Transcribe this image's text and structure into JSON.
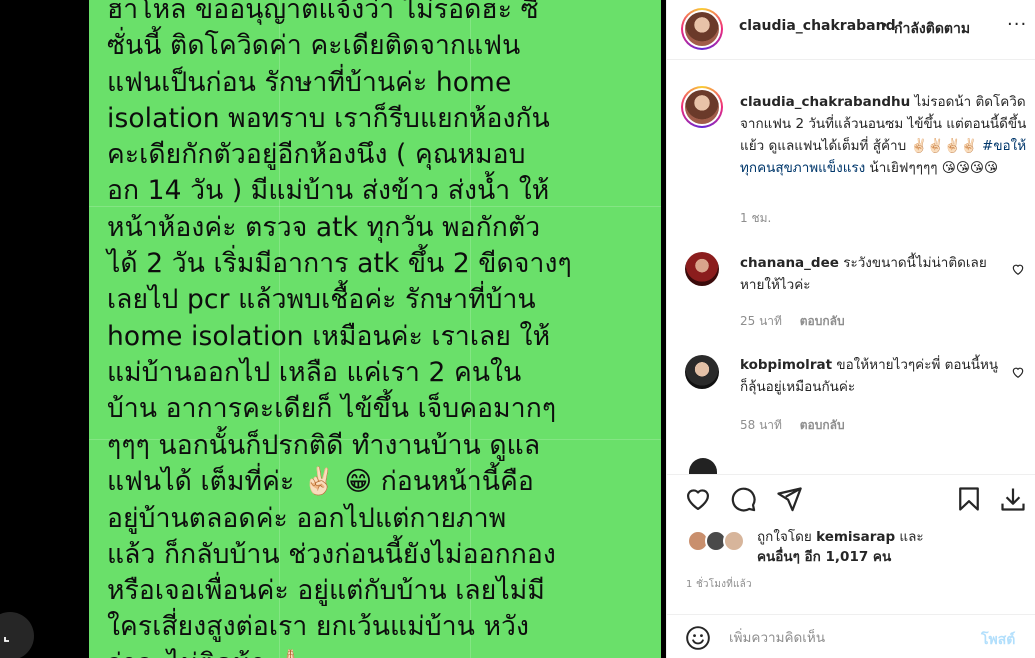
{
  "post_image": {
    "lines": [
      "ฮาโหล ขออนุญาตแจ้งว่า ไม่รอดฮะ ซี",
      "ซั่นนี้ ติดโควิดค่า คะเดียติดจากแฟน",
      "แฟนเป็นก่อน รักษาที่บ้านค่ะ home",
      "isolation พอทราบ เราก็รีบแยกห้องกัน",
      "คะเดียกักตัวอยู่อีกห้องนึง ( คุณหมอบ",
      "อก 14 วัน ) มีแม่บ้าน ส่งข้าว ส่งน้ำ ให้",
      "หน้าห้องค่ะ ตรวจ atk ทุกวัน พอกักตัว",
      "ได้ 2 วัน เริ่มมีอาการ atk ขึ้น 2 ขีดจางๆ",
      "เลยไป pcr แล้วพบเชื้อค่ะ รักษาที่บ้าน",
      "home isolation เหมือนค่ะ เราเลย ให้",
      "แม่บ้านออกไป เหลือ แค่เรา 2 คนใน",
      "บ้าน อาการคะเดียก็ ไข้ขึ้น เจ็บคอมากๆ",
      "ๆๆๆ นอกนั้นก็ปรกติดี ทำงานบ้าน ดูแล"
    ],
    "line14_a": "แฟนได้ เต็มที่ค่ะ",
    "line14_b": "ก่อนหน้านี้คือ",
    "lines_after": [
      "อยู่บ้านตลอดค่ะ ออกไปแต่กายภาพ",
      "แล้ว ก็กลับบ้าน ช่วงก่อนนี้ยังไม่ออกกอง",
      "หรือเจอเพื่อนค่ะ อยู่แต่กับบ้าน เลยไม่มี",
      "ใครเสี่ยงสูงต่อเรา ยกเว้นแม่บ้าน หวัง"
    ],
    "last_line": "ว่าจะไม่ติดน้า",
    "emoji_victory": "✌🏻",
    "emoji_grin": "😁",
    "emoji_pray": "🙏🏻"
  },
  "header": {
    "username": "claudia_chakraband",
    "dot": "•",
    "follow_label": "กำลังติดตาม",
    "more": "···"
  },
  "caption": {
    "username": "claudia_chakrabandhu",
    "text": "ไม่รอดน้า ติดโควิดจากแฟน 2 วันที่แล้วนอนซม ไข้ขึ้น แต่ตอนนี้ดีขึ้นแย้ว ดูแลแฟนได้เต็มที่ สู้ค้าบ",
    "emojis": "✌🏻✌🏻✌🏻✌🏻",
    "hashtag": "#ขอให้ทุกคนสุขภาพแข็งแรง",
    "text_after": "น้าเยิฟๆๆๆๆ",
    "kisses": "😘😘😘😘",
    "time": "1 ชม."
  },
  "comments": [
    {
      "username": "chanana_dee",
      "text": "ระวังขนาดนี้ไม่น่าติดเลย หายให้ไวค่ะ",
      "time": "25 นาที",
      "reply": "ตอบกลับ"
    },
    {
      "username": "kobpimolrat",
      "text": "ขอให้หายไวๆค่ะพี่ ตอนนี้หนูก็ลุ้นอยู่เหมือนกันค่ะ",
      "time": "58 นาที",
      "reply": "ตอบกลับ"
    }
  ],
  "likes": {
    "prefix": "ถูกใจโดย",
    "user": "kemisarap",
    "and": "และ",
    "others": "คนอื่นๆ อีก 1,017 คน"
  },
  "post_time": "1 ชั่วโมงที่แล้ว",
  "comment_bar": {
    "placeholder": "เพิ่มความคิดเห็น",
    "post_label": "โพสต์"
  },
  "colors": {
    "image_bg": "#6ae06a",
    "link": "#00376b",
    "post_disabled": "#b2dffc",
    "muted": "#8e8e8e"
  }
}
